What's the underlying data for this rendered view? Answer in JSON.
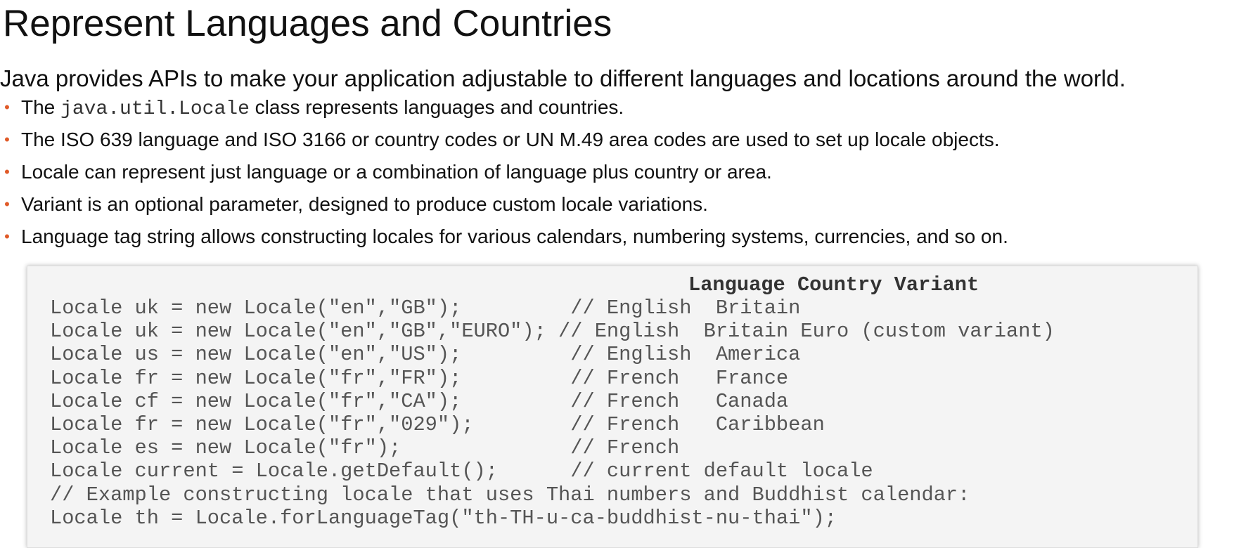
{
  "title": "Represent Languages and Countries",
  "intro": "Java provides APIs to make your application adjustable to different languages and locations around the world.",
  "bullet_marker": "•",
  "bullets": [
    {
      "before": "The ",
      "code": "java.util.Locale",
      "after": " class represents languages and countries."
    },
    {
      "before": "The ISO 639 language and ISO 3166 or country codes or UN M.49 area codes are used to set up locale objects.",
      "code": "",
      "after": ""
    },
    {
      "before": "Locale can represent just language or a combination of language plus country or area.",
      "code": "",
      "after": ""
    },
    {
      "before": "Variant is an optional parameter, designed to produce custom locale variations.",
      "code": "",
      "after": ""
    },
    {
      "before": "Language tag string allows constructing locales for various calendars, numbering systems, currencies, and so on.",
      "code": "",
      "after": ""
    }
  ],
  "code": {
    "header": "Language Country Variant",
    "lines": [
      "Locale uk = new Locale(\"en\",\"GB\");         // English  Britain",
      "Locale uk = new Locale(\"en\",\"GB\",\"EURO\"); // English  Britain Euro (custom variant)",
      "Locale us = new Locale(\"en\",\"US\");         // English  America",
      "Locale fr = new Locale(\"fr\",\"FR\");         // French   France",
      "Locale cf = new Locale(\"fr\",\"CA\");         // French   Canada",
      "Locale fr = new Locale(\"fr\",\"029\");        // French   Caribbean",
      "Locale es = new Locale(\"fr\");              // French",
      "Locale current = Locale.getDefault();      // current default locale",
      "// Example constructing locale that uses Thai numbers and Buddhist calendar:",
      "Locale th = Locale.forLanguageTag(\"th-TH-u-ca-buddhist-nu-thai\");"
    ]
  }
}
